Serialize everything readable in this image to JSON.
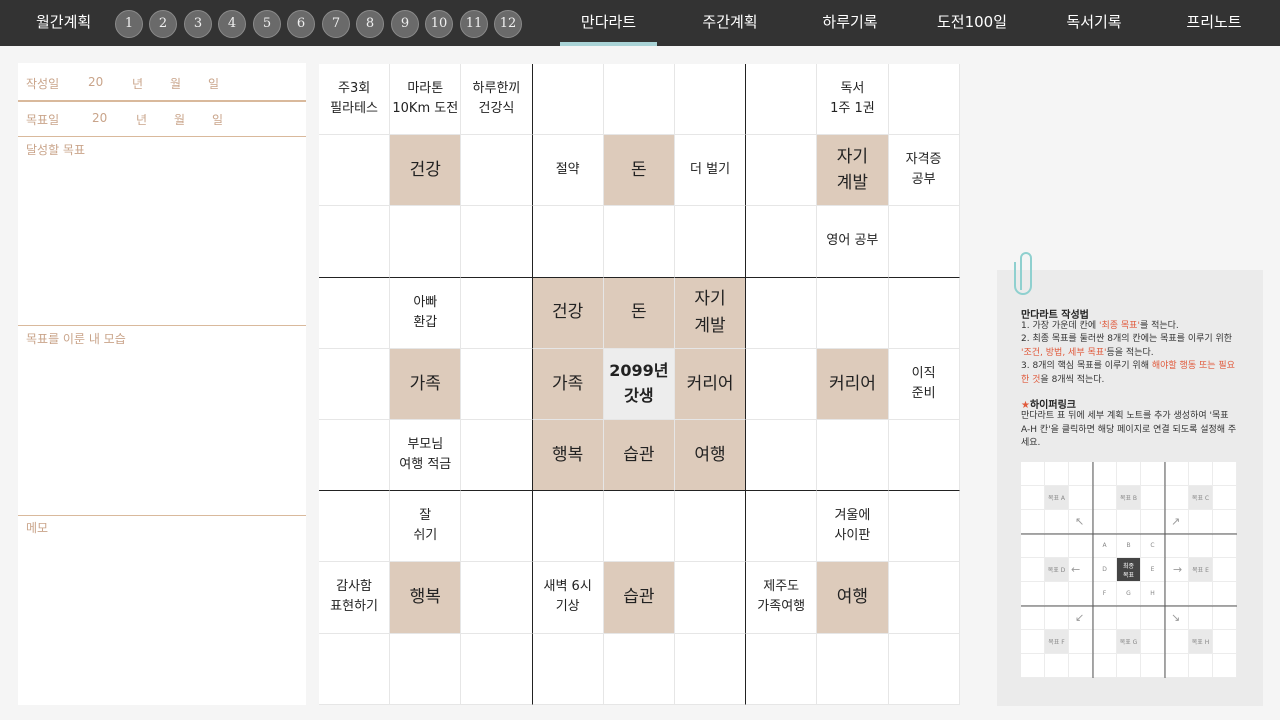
{
  "nav": {
    "title": "월간계획",
    "months": [
      "1",
      "2",
      "3",
      "4",
      "5",
      "6",
      "7",
      "8",
      "9",
      "10",
      "11",
      "12"
    ],
    "tabs": [
      "만다라트",
      "주간계획",
      "하루기록",
      "도전100일",
      "독서기록",
      "프리노트"
    ],
    "active_tab": "만다라트",
    "accent_color": "#a9d3d6"
  },
  "left": {
    "created_label": "작성일",
    "target_label": "목표일",
    "date_year_prefix": "20",
    "date_year": "년",
    "date_month": "월",
    "date_day": "일",
    "goal_label": "달성할 목표",
    "vision_label": "목표를 이룬 내 모습",
    "memo_label": "메모",
    "label_color": "#c9a48a"
  },
  "mandalart": {
    "center_goal": "2099년\n갓생",
    "highlight_color": "#ddcbbb",
    "cells": [
      [
        "주3회\n필라테스",
        "마라톤\n10Km 도전",
        "하루한끼\n건강식",
        "",
        "",
        "",
        "",
        "독서\n1주 1권",
        ""
      ],
      [
        "",
        "건강",
        "",
        "절약",
        "돈",
        "더 벌기",
        "",
        "자기\n계발",
        "자격증\n공부"
      ],
      [
        "",
        "",
        "",
        "",
        "",
        "",
        "",
        "영어 공부",
        ""
      ],
      [
        "",
        "아빠\n환갑",
        "",
        "건강",
        "돈",
        "자기\n계발",
        "",
        "",
        ""
      ],
      [
        "",
        "가족",
        "",
        "가족",
        "2099년\n갓생",
        "커리어",
        "",
        "커리어",
        "이직\n준비"
      ],
      [
        "",
        "부모님\n여행 적금",
        "",
        "행복",
        "습관",
        "여행",
        "",
        "",
        ""
      ],
      [
        "",
        "잘\n쉬기",
        "",
        "",
        "",
        "",
        "",
        "겨울에\n사이판",
        ""
      ],
      [
        "감사함\n표현하기",
        "행복",
        "",
        "새벽 6시\n기상",
        "습관",
        "",
        "제주도\n가족여행",
        "여행",
        ""
      ],
      [
        "",
        "",
        "",
        "",
        "",
        "",
        "",
        "",
        ""
      ]
    ]
  },
  "guide": {
    "title": "만다라트 작성법",
    "step1_a": "1. 가장 가운데 칸에 ",
    "step1_red": "'최종 목표'",
    "step1_b": "를 적는다.",
    "step2_a": "2. 최종 목표를 둘러싼 8개의 칸에는 목표를 이루기 위한 ",
    "step2_red": "'조건, 방법, 세부 목표'",
    "step2_b": "등을 적는다.",
    "step3_a": "3. 8개의 핵심 목표를 이루기 위해 ",
    "step3_red": "해야할 행동 또는 필요한 것",
    "step3_b": "을 8개씩 적는다.",
    "link_star": "★",
    "link_title": "하이퍼링크",
    "link_text": "만다라트 표 뒤에 세부 계획 노트를 추가 생성하여 '목표 A-H 칸'을 클릭하면 해당 페이지로 연결 되도록 설정해 주세요.",
    "mini_goals": [
      "목표 A",
      "목표 B",
      "목표 C",
      "목표 D",
      "목표 E",
      "목표 F",
      "목표 G",
      "목표 H"
    ],
    "mini_letters": [
      "A",
      "B",
      "C",
      "D",
      "E",
      "F",
      "G",
      "H"
    ],
    "mini_center": "최종\n목표"
  }
}
